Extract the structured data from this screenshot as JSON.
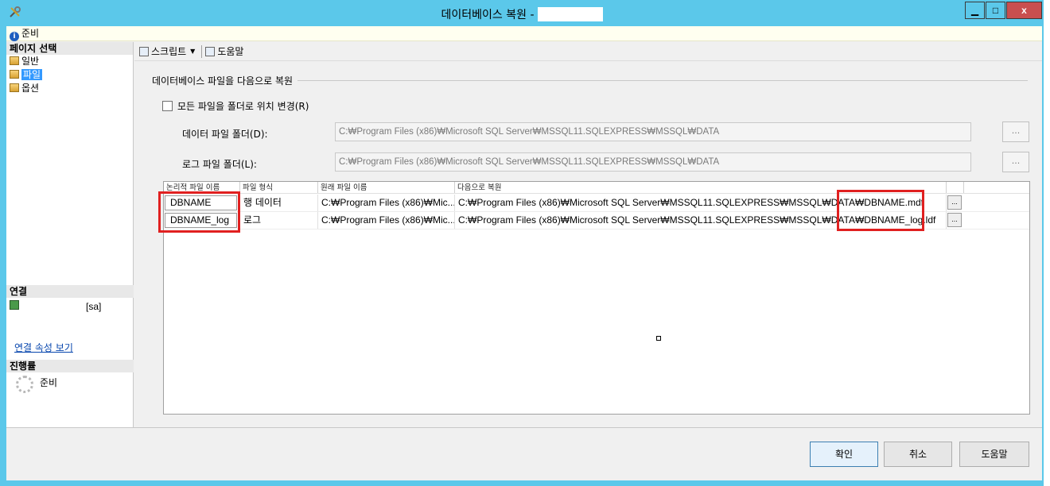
{
  "window": {
    "title": "데이터베이스 복원 -",
    "controls": {
      "minimize": "▁",
      "maximize": "□",
      "close": "x"
    }
  },
  "status": {
    "text": "준비",
    "icon": "info-icon"
  },
  "left_pane": {
    "page_select_header": "페이지 선택",
    "pages": [
      {
        "label": "일반",
        "selected": false
      },
      {
        "label": "파일",
        "selected": true
      },
      {
        "label": "옵션",
        "selected": false
      }
    ],
    "connection_header": "연결",
    "connection_user": "[sa]",
    "connection_link": "연결 속성 보기",
    "progress_header": "진행률",
    "progress_status": "준비"
  },
  "toolbar": {
    "script_label": "스크립트",
    "help_label": "도움말"
  },
  "content": {
    "group_title": "데이터베이스 파일을 다음으로 복원",
    "relocate_checkbox_label": "모든 파일을 폴더로 위치 변경(R)",
    "relocate_checked": false,
    "data_folder_label": "데이터 파일 폴더(D):",
    "data_folder_value": "C:₩Program Files (x86)₩Microsoft SQL Server₩MSSQL11.SQLEXPRESS₩MSSQL₩DATA",
    "log_folder_label": "로그 파일 폴더(L):",
    "log_folder_value": "C:₩Program Files (x86)₩Microsoft SQL Server₩MSSQL11.SQLEXPRESS₩MSSQL₩DATA",
    "browse_label": "..."
  },
  "grid": {
    "columns": [
      "논리적 파일 이름",
      "파일 형식",
      "원래 파일 이름",
      "다음으로 복원"
    ],
    "rows": [
      {
        "logical": "DBNAME",
        "type": "행 데이터",
        "original": "C:₩Program Files (x86)₩Mic...",
        "restore_as": "C:₩Program Files (x86)₩Microsoft SQL Server₩MSSQL11.SQLEXPRESS₩MSSQL₩DATA₩DBNAME.mdf",
        "browse": "..."
      },
      {
        "logical": "DBNAME_log",
        "type": "로그",
        "original": "C:₩Program Files (x86)₩Mic...",
        "restore_as": "C:₩Program Files (x86)₩Microsoft SQL Server₩MSSQL11.SQLEXPRESS₩MSSQL₩DATA₩DBNAME_log.ldf",
        "browse": "..."
      }
    ]
  },
  "buttons": {
    "ok": "확인",
    "cancel": "취소",
    "help": "도움말"
  },
  "colors": {
    "title_bar": "#5bc8ea",
    "highlight": "#e02020",
    "close_button": "#c94f4f",
    "selection": "#3399ff"
  }
}
